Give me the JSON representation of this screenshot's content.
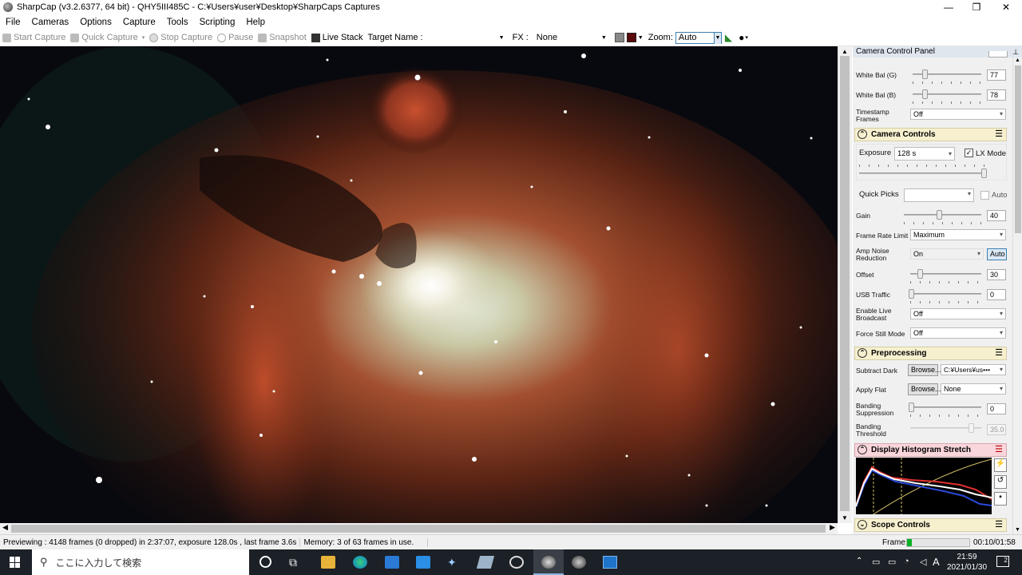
{
  "window": {
    "title": "SharpCap (v3.2.6377, 64 bit) - QHY5III485C - C:¥Users¥user¥Desktop¥SharpCaps Captures",
    "min": "—",
    "max": "❐",
    "close": "✕"
  },
  "menu": [
    "File",
    "Cameras",
    "Options",
    "Capture",
    "Tools",
    "Scripting",
    "Help"
  ],
  "toolbar": {
    "start_capture": "Start Capture",
    "quick_capture": "Quick Capture",
    "stop_capture": "Stop Capture",
    "pause": "Pause",
    "snapshot": "Snapshot",
    "live_stack": "Live Stack",
    "target_name_label": "Target Name :",
    "target_name_value": "",
    "fx_label": "FX :",
    "fx_value": "None",
    "zoom_label": "Zoom:",
    "zoom_value": "Auto"
  },
  "panel": {
    "title": "Camera Control Panel",
    "white_bal_g": {
      "label": "White Bal (G)",
      "value": "77"
    },
    "white_bal_b": {
      "label": "White Bal (B)",
      "value": "78"
    },
    "timestamp_frames": {
      "label": "Timestamp Frames",
      "value": "Off"
    },
    "camera_controls": {
      "title": "Camera Controls",
      "exposure_label": "Exposure",
      "exposure_value": "128 s",
      "lx_mode": "LX Mode",
      "quick_picks_label": "Quick Picks",
      "quick_picks_value": "",
      "auto": "Auto",
      "gain_label": "Gain",
      "gain_value": "40",
      "frame_rate_label": "Frame Rate Limit",
      "frame_rate_value": "Maximum",
      "amp_noise_label": "Amp Noise Reduction",
      "amp_noise_value": "On",
      "amp_noise_auto": "Auto",
      "offset_label": "Offset",
      "offset_value": "30",
      "usb_label": "USB Traffic",
      "usb_value": "0",
      "live_broadcast_label": "Enable Live Broadcast",
      "live_broadcast_value": "Off",
      "force_still_label": "Force Still Mode",
      "force_still_value": "Off"
    },
    "preprocessing": {
      "title": "Preprocessing",
      "subtract_dark_label": "Subtract Dark",
      "browse": "Browse...",
      "subtract_dark_value": "C:¥Users¥us•••",
      "apply_flat_label": "Apply Flat",
      "apply_flat_value": "None",
      "banding_supp_label": "Banding Suppression",
      "banding_supp_value": "0",
      "banding_thresh_label": "Banding Threshold",
      "banding_thresh_value": "35.0"
    },
    "histogram": {
      "title": "Display Histogram Stretch"
    },
    "scope": {
      "title": "Scope Controls"
    }
  },
  "status": {
    "preview": "Previewing : 4148 frames (0 dropped) in 2:37:07, exposure 128.0s , last frame 3.6s",
    "memory": "Memory: 3 of 63 frames in use.",
    "frame_label": "Frame:",
    "frame_time": "00:10/01:58",
    "frame_progress": 0.08
  },
  "taskbar": {
    "search_placeholder": "ここに入力して検索",
    "time": "21:59",
    "date": "2021/01/30",
    "ime": "A",
    "notif": "2"
  }
}
